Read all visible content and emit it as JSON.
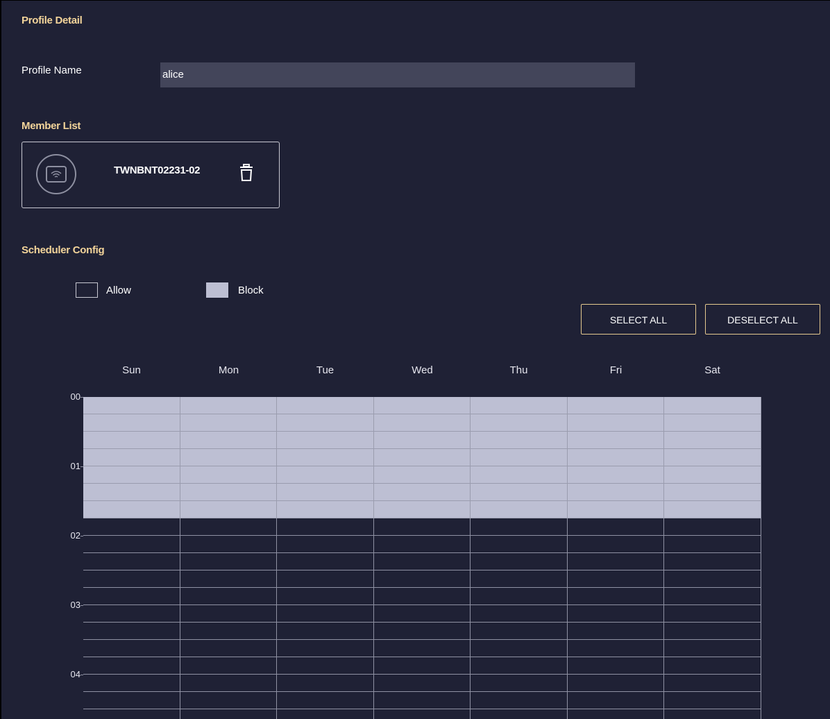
{
  "profile_detail": {
    "title": "Profile Detail",
    "profile_name_label": "Profile Name",
    "profile_name_value": "alice"
  },
  "member_list": {
    "title": "Member List",
    "members": [
      {
        "name": "TWNBNT02231-02",
        "icon": "wifi-device-icon",
        "delete_icon": "trash-icon"
      }
    ]
  },
  "scheduler": {
    "title": "Scheduler Config",
    "legend": {
      "allow_label": "Allow",
      "block_label": "Block",
      "allow_color": "#1f2135",
      "block_color": "#bdbfd3"
    },
    "select_all_label": "SELECT ALL",
    "deselect_all_label": "DESELECT ALL",
    "days": [
      "Sun",
      "Mon",
      "Tue",
      "Wed",
      "Thu",
      "Fri",
      "Sat"
    ],
    "hour_labels": [
      "00",
      "01",
      "02",
      "03",
      "04"
    ],
    "slots_per_hour": 4,
    "visible_slot_rows": 19,
    "blocked_slots": 7
  },
  "colors": {
    "background": "#1f2135",
    "accent": "#f3d49a",
    "input_bg": "#43455a",
    "grid_line": "#8f91a3"
  }
}
